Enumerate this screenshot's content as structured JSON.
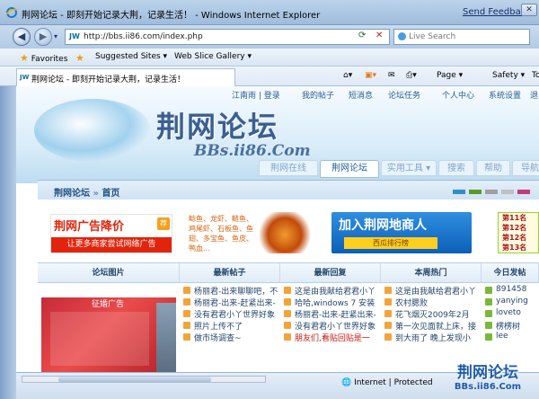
{
  "browser": {
    "window_title": "荆网论坛 - 即刻开始记录大荆，记录生活！ - Windows Internet Explorer",
    "send_feedback": "Send Feedback",
    "url": "http://bbs.ii86.com/index.php",
    "search_placeholder": "Live Search",
    "favorites": "Favorites",
    "suggested_sites": "Suggested Sites ▾",
    "web_slice_gallery": "Web Slice Gallery ▾",
    "tab_title": "荆网论坛 - 即刻开始记录大荆，记录生活！",
    "commands": {
      "page": "Page ▾",
      "safety": "Safety ▾",
      "tools": "To"
    },
    "status_zone": "Internet | Protected",
    "icon_names": [
      "ie-icon",
      "back-icon",
      "forward-icon",
      "refresh-icon",
      "stop-icon",
      "search-icon",
      "star-icon",
      "home-icon",
      "rss-icon",
      "print-icon"
    ]
  },
  "site": {
    "toplinks": [
      "江南雨 | 登录",
      "我的帖子",
      "短消息",
      "论坛任务",
      "个人中心",
      "系统设置",
      "退出"
    ],
    "logo_cn": "荆网论坛",
    "logo_en": "BBs.ii86.Com",
    "nav_tabs": [
      "荆网在线",
      "荆网论坛",
      "实用工具 ▾",
      "搜索",
      "帮助",
      "导航"
    ],
    "breadcrumb": {
      "home": "荆网论坛",
      "sep": "»",
      "current": "首页"
    },
    "swatch_colors": [
      "#2f8fcc",
      "#5a9a2a",
      "#a0a0a0",
      "#c0c0c0",
      "#c43a7a"
    ],
    "ads": {
      "ad1_title": "荆网广告降价",
      "ad1_badge": "荐",
      "ad1_sub": "让更多商家尝试网络广告",
      "ad2_text": "鲶鱼、龙虾、鲢鱼、鸡尾虾、石板鱼、鱼翅、多宝鱼、鱼皮、鸭血...",
      "ad3_title": "加入荆网地商人",
      "ad3_sub": "西瓜排行榜",
      "ad4_lines": [
        "第11名",
        "第12名",
        "第12名",
        "第13名"
      ]
    },
    "grid": {
      "headers": [
        "论坛图片",
        "最新帖子",
        "最新回复",
        "本周热门",
        "今日发帖"
      ],
      "pic_caption": "征婚广告",
      "latest_posts": [
        "杨丽君-出来聊聊吧，不",
        "杨丽君-出来-赶紧出来-",
        "没有君君小丫世界好象",
        "照片上传不了",
        "做市场调查~"
      ],
      "latest_replies": [
        "这是由我献给君君小丫",
        "哈哈,windows 7 安装",
        "杨丽君-出来-赶紧出来-",
        "没有君君小丫世界好象",
        "朋友们,看贴回贴是一"
      ],
      "weekly_hot": [
        "这是由我献给君君小丫",
        "农村腮败",
        "花飞烟灭2009年2月",
        "第一次见面就上床，接",
        "到大雨了 晚上发现小"
      ],
      "today_posts": [
        "891458",
        "yanying",
        "loveto",
        "楞楞树",
        "lee"
      ]
    }
  },
  "watermark": {
    "line1": "荆网论坛",
    "line2": "BBs.ii86.Com"
  }
}
